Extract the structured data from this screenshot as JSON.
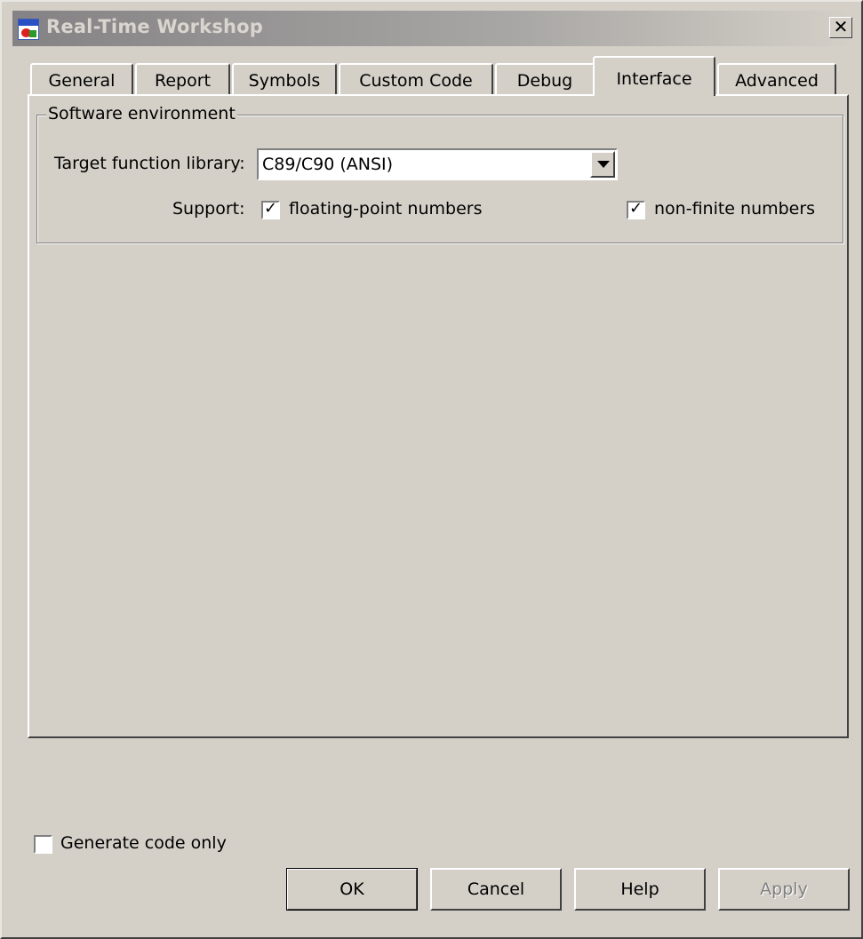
{
  "window": {
    "title": "Real-Time Workshop",
    "close_glyph": "✕"
  },
  "tabs": [
    {
      "label": "General",
      "active": false
    },
    {
      "label": "Report",
      "active": false
    },
    {
      "label": "Symbols",
      "active": false
    },
    {
      "label": "Custom Code",
      "active": false
    },
    {
      "label": "Debug",
      "active": false
    },
    {
      "label": "Interface",
      "active": true
    },
    {
      "label": "Advanced",
      "active": false
    }
  ],
  "software_environment": {
    "legend": "Software environment",
    "target_function_library_label": "Target function library:",
    "target_function_library_value": "C89/C90 (ANSI)",
    "support_label": "Support:",
    "floating_point": {
      "label": "floating-point numbers",
      "checked": true
    },
    "non_finite": {
      "label": "non-finite numbers",
      "checked": true
    }
  },
  "generate_code_only": {
    "label": "Generate code only",
    "checked": false
  },
  "buttons": {
    "ok": "OK",
    "cancel": "Cancel",
    "help": "Help",
    "apply": "Apply"
  },
  "icons": {
    "app": "matlab-model-icon",
    "close": "close-icon",
    "dropdown": "chevron-down-icon",
    "check": "checkmark-icon"
  }
}
